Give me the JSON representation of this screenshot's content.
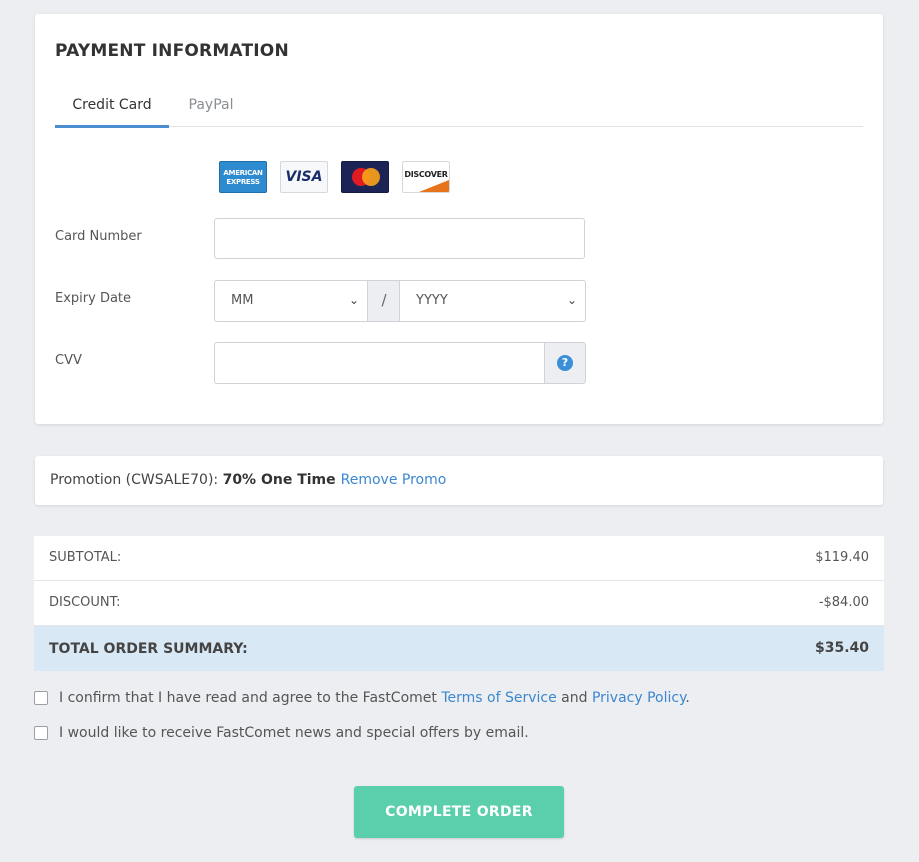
{
  "payment": {
    "title": "PAYMENT INFORMATION",
    "tabs": [
      {
        "label": "Credit Card",
        "active": true
      },
      {
        "label": "PayPal",
        "active": false
      }
    ],
    "card_logos": {
      "amex_line1": "AMERICAN",
      "amex_line2": "EXPRESS",
      "visa": "VISA",
      "discover": "DISCOVER"
    },
    "card_number": {
      "label": "Card Number",
      "value": "",
      "placeholder": ""
    },
    "expiry": {
      "label": "Expiry Date",
      "month": "MM",
      "separator": "/",
      "year": "YYYY"
    },
    "cvv": {
      "label": "CVV",
      "value": "",
      "help_icon": "question-circle-icon",
      "help_symbol": "?"
    }
  },
  "promo": {
    "prefix": "Promotion (CWSALE70): ",
    "value": "70% One Time",
    "remove_label": "Remove Promo"
  },
  "summary": {
    "subtotal_label": "SUBTOTAL:",
    "subtotal_value": "$119.40",
    "discount_label": "DISCOUNT:",
    "discount_value": "-$84.00",
    "total_label": "TOTAL ORDER SUMMARY:",
    "total_value": "$35.40"
  },
  "agreements": {
    "terms": {
      "checked": false,
      "text_before": "I confirm that I have read and agree to the FastComet ",
      "tos_link": "Terms of Service",
      "text_mid": " and ",
      "privacy_link": "Privacy Policy",
      "text_after": "."
    },
    "newsletter": {
      "checked": false,
      "text": "I would like to receive FastComet news and special offers by email."
    }
  },
  "complete_button": "COMPLETE ORDER",
  "colors": {
    "accent": "#4a8ecf",
    "link": "#3b87d0",
    "button": "#5bcfab",
    "total_row": "#d9e8f5",
    "background": "#eceef1"
  }
}
